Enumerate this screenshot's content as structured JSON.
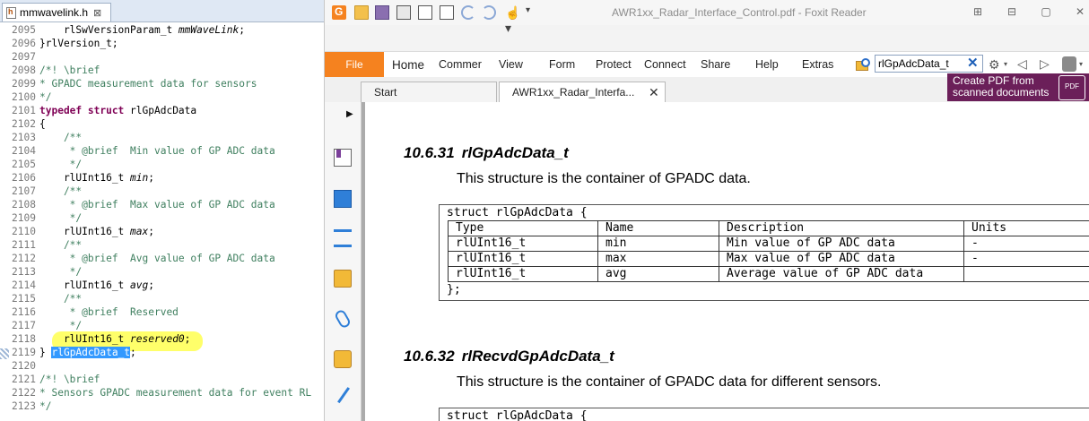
{
  "editor": {
    "tab_label": "mmwavelink.h",
    "tab_close": "⊠",
    "lines": [
      {
        "n": "2095",
        "parts": [
          {
            "c": "ty",
            "t": "    rlSwVersionParam_t "
          },
          {
            "c": "it",
            "t": "mmWaveLink"
          },
          {
            "c": "ty",
            "t": ";"
          }
        ]
      },
      {
        "n": "2096",
        "parts": [
          {
            "c": "ty",
            "t": "}rlVersion_t;"
          }
        ]
      },
      {
        "n": "2097",
        "parts": []
      },
      {
        "n": "2098",
        "parts": [
          {
            "c": "cm",
            "t": "/*! \\brief"
          }
        ]
      },
      {
        "n": "2099",
        "parts": [
          {
            "c": "cm",
            "t": "* GPADC measurement data for sensors"
          }
        ]
      },
      {
        "n": "2100",
        "parts": [
          {
            "c": "cm",
            "t": "*/"
          }
        ]
      },
      {
        "n": "2101",
        "parts": [
          {
            "c": "kw",
            "t": "typedef struct "
          },
          {
            "c": "ty",
            "t": "rlGpAdcData"
          }
        ]
      },
      {
        "n": "2102",
        "parts": [
          {
            "c": "ty",
            "t": "{"
          }
        ]
      },
      {
        "n": "2103",
        "parts": [
          {
            "c": "cm",
            "t": "    /**"
          }
        ]
      },
      {
        "n": "2104",
        "parts": [
          {
            "c": "cm",
            "t": "     * @brief  Min value of GP ADC data"
          }
        ]
      },
      {
        "n": "2105",
        "parts": [
          {
            "c": "cm",
            "t": "     */"
          }
        ]
      },
      {
        "n": "2106",
        "parts": [
          {
            "c": "ty",
            "t": "    rlUInt16_t "
          },
          {
            "c": "it",
            "t": "min"
          },
          {
            "c": "ty",
            "t": ";"
          }
        ]
      },
      {
        "n": "2107",
        "parts": [
          {
            "c": "cm",
            "t": "    /**"
          }
        ]
      },
      {
        "n": "2108",
        "parts": [
          {
            "c": "cm",
            "t": "     * @brief  Max value of GP ADC data"
          }
        ]
      },
      {
        "n": "2109",
        "parts": [
          {
            "c": "cm",
            "t": "     */"
          }
        ]
      },
      {
        "n": "2110",
        "parts": [
          {
            "c": "ty",
            "t": "    rlUInt16_t "
          },
          {
            "c": "it",
            "t": "max"
          },
          {
            "c": "ty",
            "t": ";"
          }
        ]
      },
      {
        "n": "2111",
        "parts": [
          {
            "c": "cm",
            "t": "    /**"
          }
        ]
      },
      {
        "n": "2112",
        "parts": [
          {
            "c": "cm",
            "t": "     * @brief  Avg value of GP ADC data"
          }
        ]
      },
      {
        "n": "2113",
        "parts": [
          {
            "c": "cm",
            "t": "     */"
          }
        ]
      },
      {
        "n": "2114",
        "parts": [
          {
            "c": "ty",
            "t": "    rlUInt16_t "
          },
          {
            "c": "it",
            "t": "avg"
          },
          {
            "c": "ty",
            "t": ";"
          }
        ]
      },
      {
        "n": "2115",
        "parts": [
          {
            "c": "cm",
            "t": "    /**"
          }
        ]
      },
      {
        "n": "2116",
        "parts": [
          {
            "c": "cm",
            "t": "     * @brief  Reserved"
          }
        ]
      },
      {
        "n": "2117",
        "parts": [
          {
            "c": "cm",
            "t": "     */"
          }
        ]
      },
      {
        "n": "2118",
        "parts": [
          {
            "c": "ty",
            "t": "    rlUInt16_t "
          },
          {
            "c": "it",
            "t": "reserved0"
          },
          {
            "c": "ty",
            "t": ";"
          }
        ]
      },
      {
        "n": "2119",
        "parts": [
          {
            "c": "ty",
            "t": "} "
          },
          {
            "c": "sel",
            "t": "rlGpAdcData_t"
          },
          {
            "c": "ty",
            "t": ";"
          }
        ]
      },
      {
        "n": "2120",
        "parts": []
      },
      {
        "n": "2121",
        "parts": [
          {
            "c": "cm",
            "t": "/*! \\brief"
          }
        ]
      },
      {
        "n": "2122",
        "parts": [
          {
            "c": "cm",
            "t": "* Sensors GPADC measurement data for event RL"
          }
        ]
      },
      {
        "n": "2123",
        "parts": [
          {
            "c": "cm",
            "t": "*/"
          }
        ]
      }
    ]
  },
  "reader": {
    "window_title": "AWR1xx_Radar_Interface_Control.pdf - Foxit Reader",
    "qa_more": "▾",
    "hand_icon_glyph": "☝▾",
    "win_controls": {
      "layout": "⊞",
      "minimize": "⊟",
      "maximize": "▢",
      "close": "✕"
    },
    "file_label": "File",
    "menu": [
      "Home",
      "Commer",
      "View",
      "Form",
      "Protect",
      "Connect",
      "Share",
      "Help",
      "Extras"
    ],
    "search_value": "rlGpAdcData_t",
    "search_clear": "✕",
    "settings_glyph": "⚙",
    "nav_prev": "◁",
    "nav_next": "▷",
    "dropdown": "▾",
    "tabs": {
      "start": "Start",
      "active": "AWR1xx_Radar_Interfa...",
      "close": "✕"
    },
    "ad": {
      "line1": "Create PDF from",
      "line2": "scanned documents",
      "badge": "PDF"
    },
    "sidebar_expand": "▶"
  },
  "document": {
    "sections": [
      {
        "number": "10.6.31",
        "title": "rlGpAdcData_t",
        "description": "This structure is the container of GPADC data.",
        "struct_open": "struct rlGpAdcData {",
        "struct_close": "};",
        "headers": [
          "Type",
          "Name",
          "Description",
          "Units"
        ],
        "rows": [
          [
            "rlUInt16_t",
            "min",
            "Min value of GP ADC data",
            "-"
          ],
          [
            "rlUInt16_t",
            "max",
            "Max value of GP ADC data",
            "-"
          ],
          [
            "rlUInt16_t",
            "avg",
            "Average value of GP ADC data",
            ""
          ]
        ]
      },
      {
        "number": "10.6.32",
        "title": "rlRecvdGpAdcData_t",
        "description": "This structure is the container of GPADC data for different sensors.",
        "struct_open": "struct rlGpAdcData {"
      }
    ]
  },
  "colors": {
    "accent": "#f5821f",
    "ad_bg": "#6b1f59",
    "selection": "#3399ff",
    "highlight": "#ffff5a"
  }
}
